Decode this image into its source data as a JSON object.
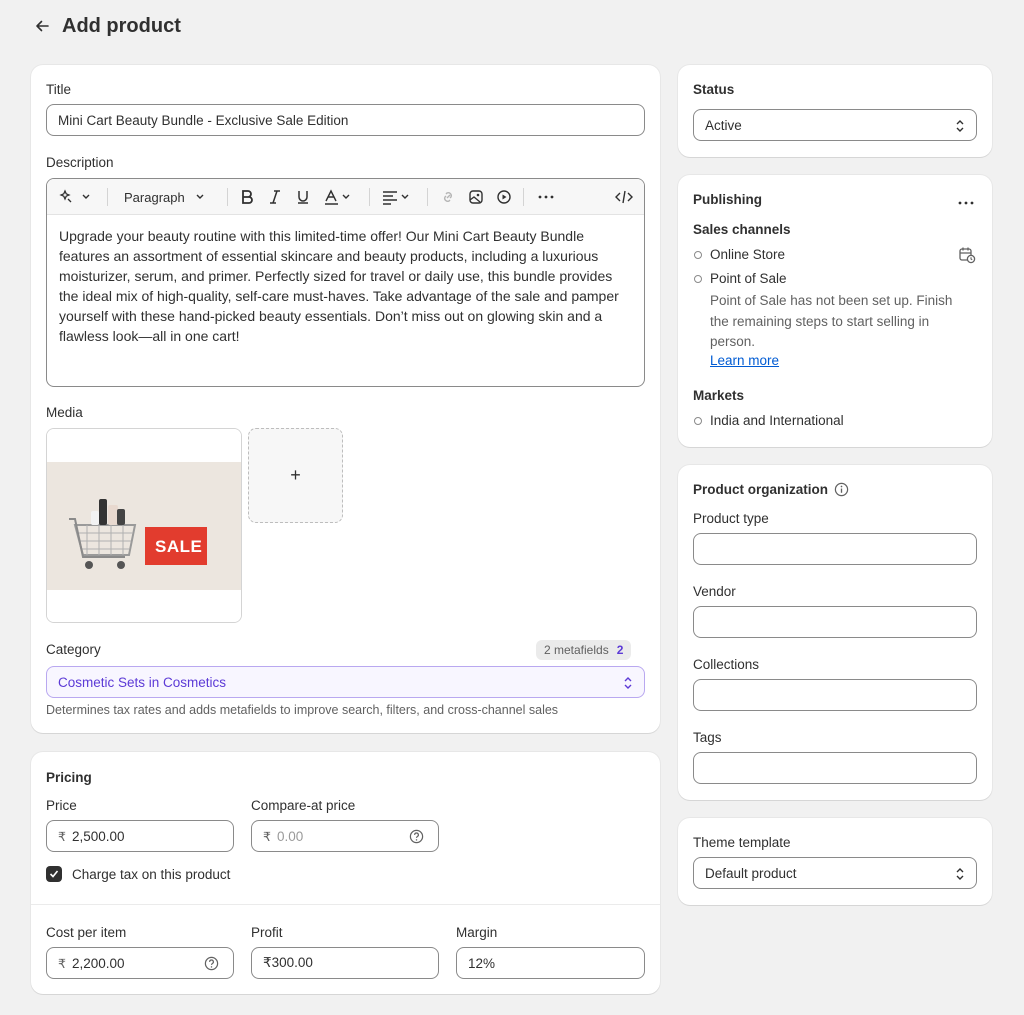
{
  "header": {
    "title": "Add product"
  },
  "main": {
    "title_label": "Title",
    "title_value": "Mini Cart Beauty Bundle - Exclusive Sale Edition",
    "description_label": "Description",
    "toolbar": {
      "paragraph": "Paragraph"
    },
    "description_text": "Upgrade your beauty routine with this limited-time offer! Our Mini Cart Beauty Bundle features an assortment of essential skincare and beauty products, including a luxurious moisturizer, serum, and primer. Perfectly sized for travel or daily use, this bundle provides the ideal mix of high-quality, self-care must-haves. Take advantage of the sale and pamper yourself with these hand-picked beauty essentials. Don’t miss out on glowing skin and a flawless look—all in one cart!",
    "media_label": "Media",
    "media_image_text": "SALE",
    "media_add": "+",
    "category_label": "Category",
    "metafields_label": "2 metafields",
    "metafields_count": "2",
    "category_value_name": "Cosmetic Sets",
    "category_value_in": " in ",
    "category_value_parent": "Cosmetics",
    "category_help": "Determines tax rates and adds metafields to improve search, filters, and cross-channel sales"
  },
  "pricing": {
    "title": "Pricing",
    "price_label": "Price",
    "currency": "₹",
    "price_value": "2,500.00",
    "compare_label": "Compare-at price",
    "compare_placeholder": "0.00",
    "charge_tax_label": "Charge tax on this product",
    "cost_label": "Cost per item",
    "cost_value": "2,200.00",
    "profit_label": "Profit",
    "profit_value": "₹300.00",
    "margin_label": "Margin",
    "margin_value": "12%"
  },
  "status": {
    "label": "Status",
    "value": "Active"
  },
  "publishing": {
    "title": "Publishing",
    "sales_channels_label": "Sales channels",
    "channels": [
      "Online Store",
      "Point of Sale"
    ],
    "pos_note": "Point of Sale has not been set up. Finish the remaining steps to start selling in person.",
    "learn_more": "Learn more",
    "markets_label": "Markets",
    "markets": [
      "India and International"
    ]
  },
  "organization": {
    "title": "Product organization",
    "product_type_label": "Product type",
    "vendor_label": "Vendor",
    "collections_label": "Collections",
    "tags_label": "Tags"
  },
  "theme": {
    "label": "Theme template",
    "value": "Default product"
  }
}
